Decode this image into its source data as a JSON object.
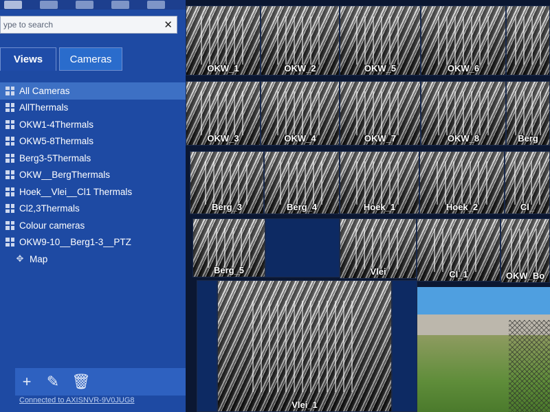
{
  "search": {
    "placeholder": "ype to search",
    "clear_icon": "✕"
  },
  "tabs": [
    {
      "label": "Views"
    },
    {
      "label": "Cameras"
    }
  ],
  "views": [
    {
      "label": "All Cameras",
      "icon": "grid-icon",
      "selected": true
    },
    {
      "label": "AllThermals",
      "icon": "grid-icon"
    },
    {
      "label": "OKW1-4Thermals",
      "icon": "grid-icon"
    },
    {
      "label": "OKW5-8Thermals",
      "icon": "grid-icon"
    },
    {
      "label": "Berg3-5Thermals",
      "icon": "grid-icon"
    },
    {
      "label": "OKW__BergThermals",
      "icon": "grid-icon"
    },
    {
      "label": "Hoek__Vlei__Cl1 Thermals",
      "icon": "grid-icon"
    },
    {
      "label": "Cl2,3Thermals",
      "icon": "grid-icon"
    },
    {
      "label": "Colour cameras",
      "icon": "grid-icon"
    },
    {
      "label": "OKW9-10__Berg1-3__PTZ",
      "icon": "grid-icon"
    },
    {
      "label": "Map",
      "icon": "map-icon"
    }
  ],
  "bottom_bar": {
    "add": "+",
    "edit": "✎",
    "delete": "🗑"
  },
  "status": "Connected to AXISNVR-9V0JUG8",
  "cameras": [
    "OKW_1",
    "OKW_2",
    "OKW_5",
    "OKW_6",
    "OKW_3",
    "OKW_4",
    "OKW_7",
    "OKW_8",
    "Berg",
    "Berg_3",
    "Berg_4",
    "Hoek_1",
    "Hoek_2",
    "Cl_",
    "Berg_5",
    "Vlei",
    "Cl_1",
    "OKW_Bo",
    "Vlei_1"
  ],
  "colors": {
    "panel": "#1e4aa3",
    "selected": "#3d70c4",
    "tab_active": "#2a6ccc"
  }
}
